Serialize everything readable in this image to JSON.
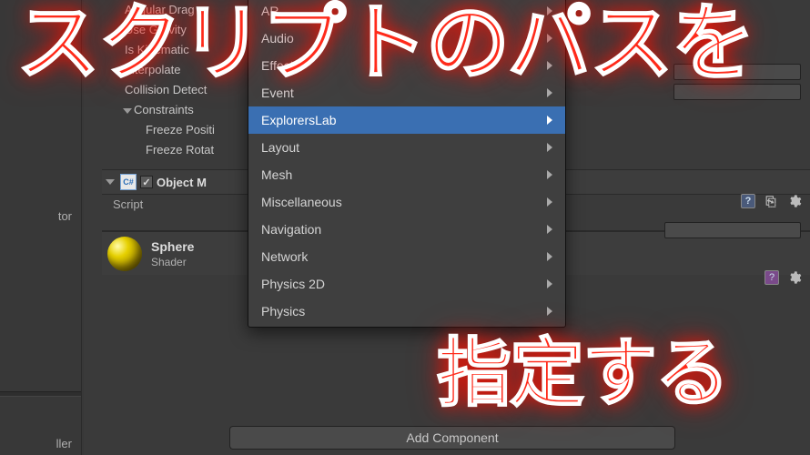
{
  "left_panel": {
    "item_tor": "tor",
    "item_ller": "ller"
  },
  "inspector": {
    "rows": {
      "angular_drag": "Angular Drag",
      "use_gravity": "Use Gravity",
      "is_kinematic": "Is Kinematic",
      "interpolate": "Interpolate",
      "collision_detect": "Collision Detect",
      "constraints": "Constraints",
      "freeze_position": "Freeze Positi",
      "freeze_rotation": "Freeze Rotat"
    },
    "script_component": {
      "title": "Object M",
      "script_label": "Script"
    },
    "material": {
      "name": "Sphere",
      "shader_label": "Shader"
    },
    "add_component": "Add Component"
  },
  "dropdown": {
    "items": [
      {
        "label": "AR",
        "selected": false
      },
      {
        "label": "Audio",
        "selected": false
      },
      {
        "label": "Effects",
        "selected": false
      },
      {
        "label": "Event",
        "selected": false
      },
      {
        "label": "ExplorersLab",
        "selected": true
      },
      {
        "label": "Layout",
        "selected": false
      },
      {
        "label": "Mesh",
        "selected": false
      },
      {
        "label": "Miscellaneous",
        "selected": false
      },
      {
        "label": "Navigation",
        "selected": false
      },
      {
        "label": "Network",
        "selected": false
      },
      {
        "label": "Physics 2D",
        "selected": false
      },
      {
        "label": "Physics",
        "selected": false
      }
    ]
  },
  "overlay": {
    "line1": "スクリプトのパスを",
    "line2": "指定する"
  }
}
